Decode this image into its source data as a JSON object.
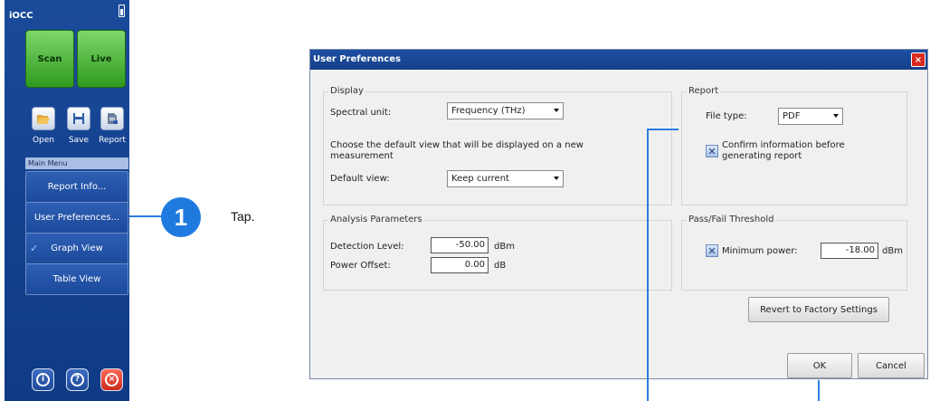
{
  "sidebar": {
    "title": "iOCC",
    "scan_label": "Scan",
    "live_label": "Live",
    "tools": [
      {
        "label": "Open",
        "icon": "folder-open-icon"
      },
      {
        "label": "Save",
        "icon": "floppy-disk-icon"
      },
      {
        "label": "Report",
        "icon": "report-document-icon"
      }
    ],
    "menu_header": "Main Menu",
    "menu_items": [
      {
        "label": "Report Info..."
      },
      {
        "label": "User Preferences..."
      },
      {
        "label": "Graph View",
        "checked": true
      },
      {
        "label": "Table View"
      }
    ],
    "bottom_buttons": [
      {
        "icon": "info-icon",
        "glyph": "i"
      },
      {
        "icon": "help-icon",
        "glyph": "?"
      },
      {
        "icon": "close-icon",
        "glyph": "×"
      }
    ]
  },
  "callout": {
    "number": "1",
    "text": "Tap."
  },
  "dialog": {
    "title": "User Preferences",
    "close_glyph": "×",
    "display": {
      "group_title": "Display",
      "spectral_unit_label": "Spectral unit:",
      "spectral_unit_value": "Frequency (THz)",
      "description": "Choose the default view that will be displayed on a new measurement",
      "default_view_label": "Default view:",
      "default_view_value": "Keep current"
    },
    "report": {
      "group_title": "Report",
      "file_type_label": "File type:",
      "file_type_value": "PDF",
      "confirm_label": "Confirm information before generating report",
      "confirm_checked": true
    },
    "analysis": {
      "group_title": "Analysis Parameters",
      "detection_label": "Detection Level:",
      "detection_value": "-50.00",
      "detection_unit": "dBm",
      "offset_label": "Power Offset:",
      "offset_value": "0.00",
      "offset_unit": "dB"
    },
    "threshold": {
      "group_title": "Pass/Fail Threshold",
      "min_power_label": "Minimum power:",
      "min_power_value": "-18.00",
      "min_power_unit": "dBm",
      "min_power_checked": true
    },
    "revert_label": "Revert to Factory Settings",
    "ok_label": "OK",
    "cancel_label": "Cancel"
  },
  "colors": {
    "sidebar_blue": "#1a4a9a",
    "scan_green": "#2f9a1e",
    "callout_blue": "#1f7ae0",
    "dialog_title_blue": "#1d4fa6",
    "close_red": "#d9281c"
  }
}
